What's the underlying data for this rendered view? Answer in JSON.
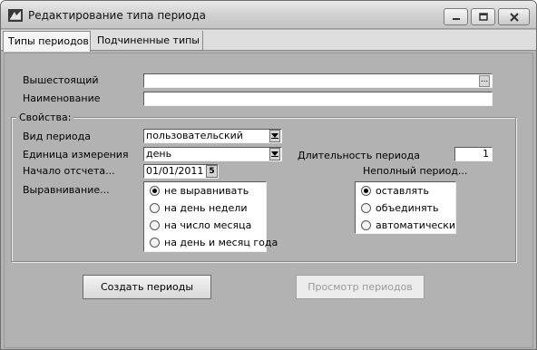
{
  "window": {
    "title": "Редактирование типа периода",
    "icon": "app-icon",
    "controls": {
      "minimize": "minimize-icon",
      "maximize": "maximize-icon",
      "close": "close-icon"
    }
  },
  "tabs": [
    {
      "label": "Типы периодов",
      "active": true
    },
    {
      "label": "Подчиненные типы",
      "active": false
    }
  ],
  "form": {
    "parent_label": "Вышестоящий",
    "parent_value": "",
    "parent_button": "...",
    "name_label": "Наименование",
    "name_value": "",
    "properties_title": "Свойства:",
    "kind_label": "Вид периода",
    "kind_value": "пользовательский",
    "unit_label": "Единица измерения",
    "unit_value": "день",
    "duration_label": "Длительность периода",
    "duration_value": "1",
    "start_label": "Начало отсчета...",
    "start_value": "01/01/2011",
    "start_button": "5",
    "align_label": "Выравнивание...",
    "align_options": [
      {
        "label": "не выравнивать",
        "checked": true
      },
      {
        "label": "на день недели",
        "checked": false
      },
      {
        "label": "на число месяца",
        "checked": false
      },
      {
        "label": "на день и месяц года",
        "checked": false
      }
    ],
    "partial_label": "Неполный период...",
    "partial_options": [
      {
        "label": "оставлять",
        "checked": true
      },
      {
        "label": "объединять",
        "checked": false
      },
      {
        "label": "автоматически",
        "checked": false
      }
    ]
  },
  "buttons": {
    "create": "Создать периоды",
    "view": "Просмотр периодов"
  }
}
